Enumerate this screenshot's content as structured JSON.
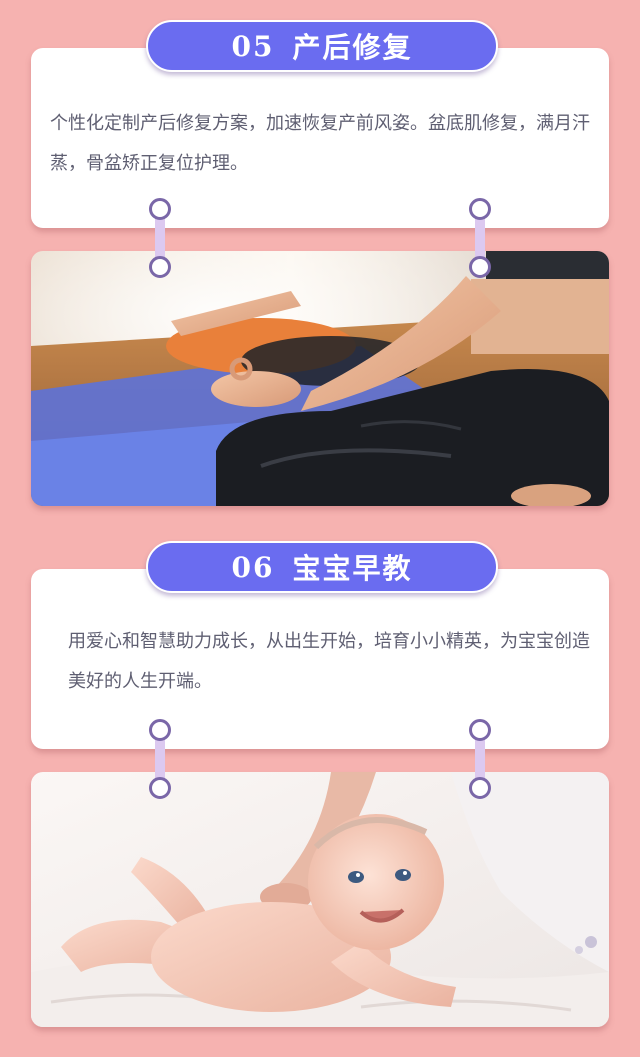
{
  "sections": [
    {
      "number": "05",
      "title": "产后修复",
      "description": "个性化定制产后修复方案，加速恢复产前风姿。盆底肌修复，满月汗蒸，骨盆矫正复位护理。"
    },
    {
      "number": "06",
      "title": "宝宝早教",
      "description": "用爱心和智慧助力成长，从出生开始，培育小小精英，为宝宝创造美好的人生开端。"
    }
  ],
  "colors": {
    "background": "#f6b2b0",
    "pill": "#6a6cf0",
    "connector_ring": "#7a67a8",
    "connector_bar": "#dcc9f0",
    "text": "#5f5f72"
  }
}
